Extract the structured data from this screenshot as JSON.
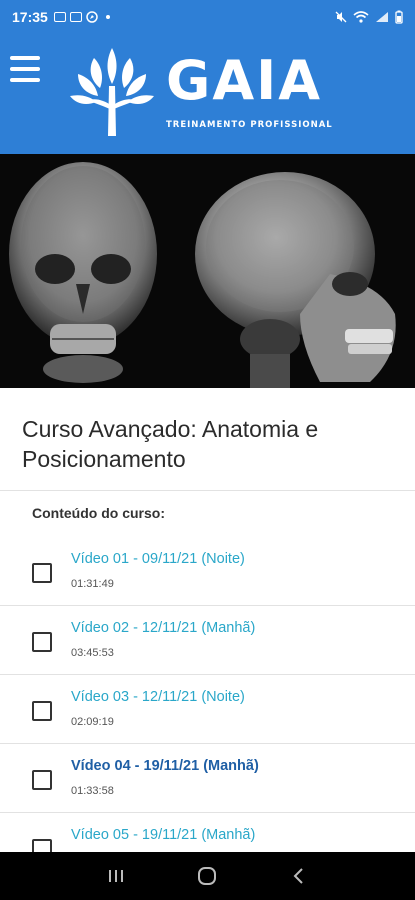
{
  "status_bar": {
    "time": "17:35"
  },
  "header": {
    "logo_text": "GAIA",
    "logo_subtitle": "TREINAMENTO PROFISSIONAL"
  },
  "course": {
    "title": "Curso Avançado: Anatomia e Posicionamento",
    "content_label": "Conteúdo do curso:"
  },
  "lessons": [
    {
      "title": "Vídeo 01 - 09/11/21 (Noite)",
      "duration": "01:31:49"
    },
    {
      "title": "Vídeo 02 - 12/11/21 (Manhã)",
      "duration": "03:45:53"
    },
    {
      "title": "Vídeo 03 - 12/11/21 (Noite)",
      "duration": "02:09:19"
    },
    {
      "title": "Vídeo 04 - 19/11/21 (Manhã)",
      "duration": "01:33:58"
    },
    {
      "title": "Vídeo 05 - 19/11/21 (Manhã)",
      "duration": ""
    }
  ],
  "colors": {
    "brand_blue": "#2e7fd6",
    "lesson_link": "#2aa7c9",
    "lesson_active": "#1f5fa5"
  }
}
